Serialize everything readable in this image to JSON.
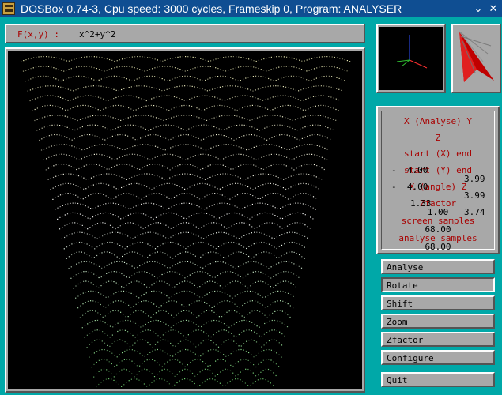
{
  "window": {
    "title": "DOSBox 0.74-3, Cpu speed: 3000 cycles, Frameskip 0, Program: ANALYSER",
    "menu_glyph": "⌄",
    "close_glyph": "✕",
    "icon": "dosbox-icon"
  },
  "formula": {
    "label": "F(x,y) : ",
    "value": "x^2+y^2"
  },
  "plot": {
    "background": "#000000",
    "colors": {
      "top": "#e8e8b0",
      "middle": "#ffffff",
      "bottom": "#70d070"
    }
  },
  "axes_view": {
    "x_color": "#ff3030",
    "y_color": "#3050ff",
    "z_color": "#30c030"
  },
  "info": {
    "title": "X (Analyse) Y",
    "z_label": "Z",
    "x_range": {
      "label": "start (X) end",
      "start": "-  4.00",
      "end": "3.99"
    },
    "y_range": {
      "label": "start (Y) end",
      "start": "-  4.00",
      "end": "3.99"
    },
    "angles": {
      "label": "X (angle) Z",
      "x": "1.33",
      "z": "3.74"
    },
    "zfactor": {
      "label": "Zfactor",
      "value": "1.00"
    },
    "screen_samples": {
      "label": "screen samples",
      "value": "68.00"
    },
    "analyse_samples": {
      "label": "analyse samples",
      "value": "68.00"
    }
  },
  "buttons": {
    "analyse": "Analyse",
    "rotate": "Rotate",
    "shift": "Shift",
    "zoom": "Zoom",
    "zfactor": "Zfactor",
    "configure": "Configure",
    "quit": "Quit"
  },
  "active_button": "rotate"
}
